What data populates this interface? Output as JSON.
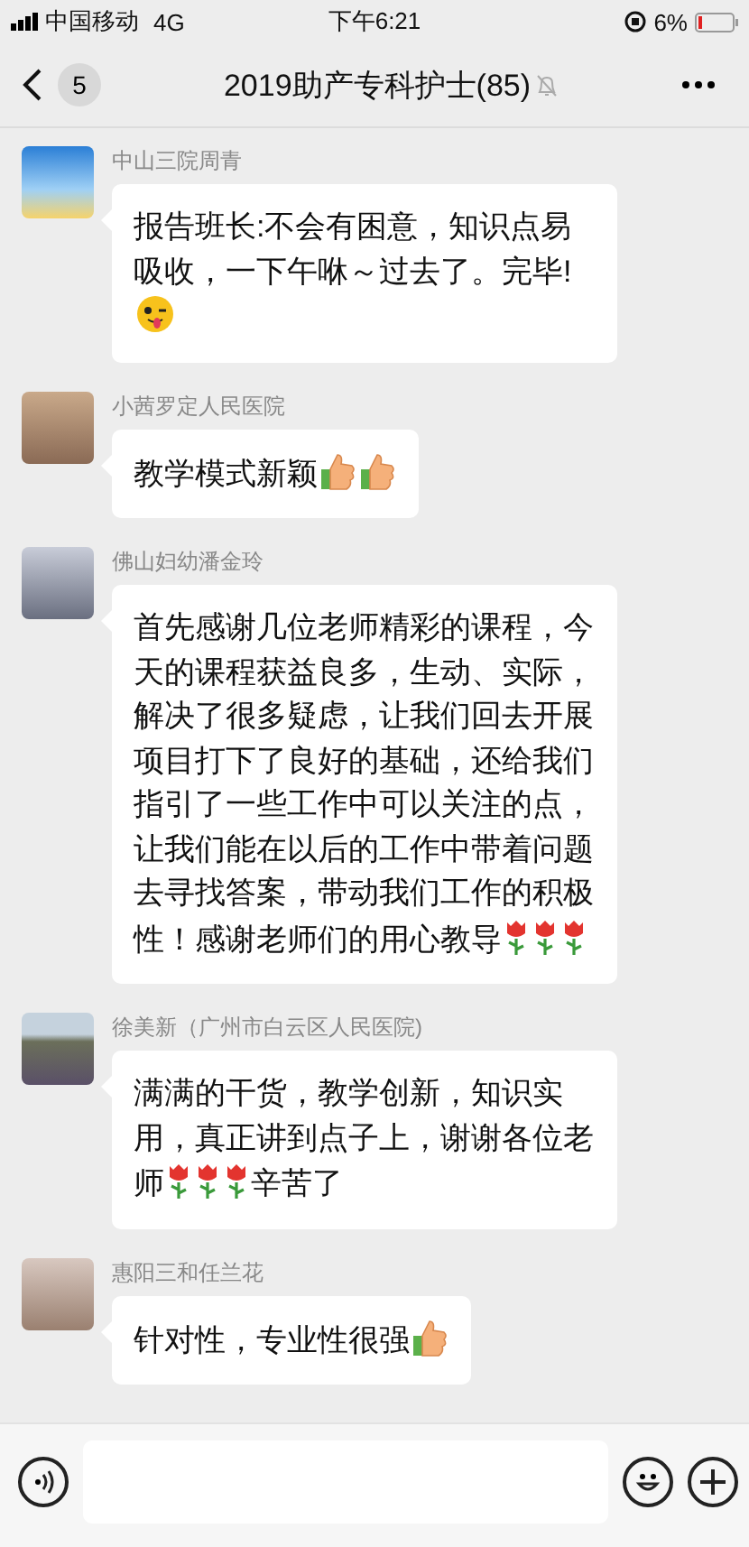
{
  "status_bar": {
    "carrier": "中国移动",
    "network": "4G",
    "time": "下午6:21",
    "battery": "6%"
  },
  "nav": {
    "unread": "5",
    "title": "2019助产专科护士(85)",
    "muted": true
  },
  "messages": [
    {
      "sender": "中山三院周青",
      "parts": [
        {
          "kind": "text",
          "text": "报告班长:不会有困意，知识点易吸收，一下午咻～过去了。完毕!"
        },
        {
          "kind": "wink"
        }
      ]
    },
    {
      "sender": "小茜罗定人民医院",
      "parts": [
        {
          "kind": "text",
          "text": "教学模式新颖"
        },
        {
          "kind": "thumb"
        },
        {
          "kind": "thumb"
        }
      ]
    },
    {
      "sender": "佛山妇幼潘金玲",
      "parts": [
        {
          "kind": "text",
          "text": "首先感谢几位老师精彩的课程，今天的课程获益良多，生动、实际，解决了很多疑虑，让我们回去开展项目打下了良好的基础，还给我们指引了一些工作中可以关注的点，让我们能在以后的工作中带着问题去寻找答案，带动我们工作的积极性！感谢老师们的用心教导"
        },
        {
          "kind": "rose"
        },
        {
          "kind": "rose"
        },
        {
          "kind": "rose"
        }
      ]
    },
    {
      "sender": "徐美新（广州市白云区人民医院)",
      "parts": [
        {
          "kind": "text",
          "text": "满满的干货，教学创新，知识实用，真正讲到点子上，谢谢各位老师"
        },
        {
          "kind": "rose"
        },
        {
          "kind": "rose"
        },
        {
          "kind": "rose"
        },
        {
          "kind": "text",
          "text": "辛苦了"
        }
      ]
    },
    {
      "sender": "惠阳三和任兰花",
      "parts": [
        {
          "kind": "text",
          "text": "针对性，专业性很强"
        },
        {
          "kind": "thumb"
        }
      ]
    }
  ]
}
